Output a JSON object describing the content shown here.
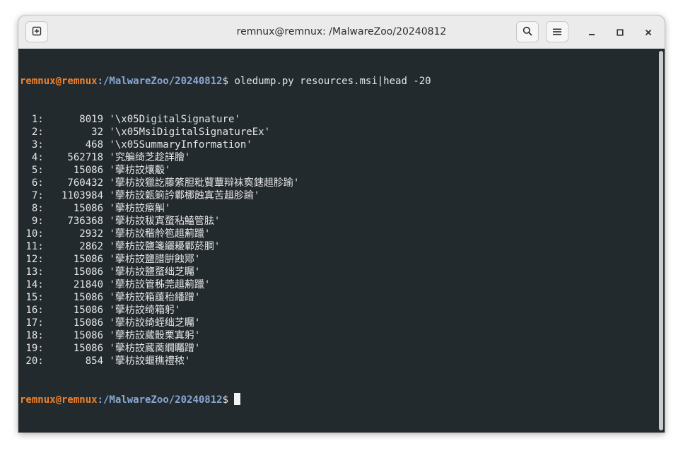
{
  "window": {
    "title": "remnux@remnux: /MalwareZoo/20240812",
    "new_tab_icon": "new-tab-icon",
    "search_icon": "search-icon",
    "menu_icon": "hamburger-menu-icon",
    "minimize_icon": "minimize-icon",
    "maximize_icon": "maximize-icon",
    "close_icon": "close-icon"
  },
  "colors": {
    "prompt_user": "#f0812a",
    "prompt_path": "#88a8d4",
    "terminal_bg": "#232a2e",
    "terminal_fg": "#e6e6e6"
  },
  "terminal": {
    "prompt_user": "remnux@remnux",
    "prompt_path": ":/MalwareZoo/20240812",
    "prompt_symbol": "$ ",
    "command": "oledump.py resources.msi|head -20",
    "output": [
      "  1:      8019 '\\x05DigitalSignature'",
      "  2:        32 '\\x05MsiDigitalSignatureEx'",
      "  3:       468 '\\x05SummaryInformation'",
      "  4:    562718 '究艑绮芝趁詳膾'",
      "  5:     15086 '䖂枋詨爙觳'",
      "  6:    760432 '䖂枋詨獵訖藤綮胆粃藖蕈辩袜寏鎋趄胗踰'",
      "  7:   1103984 '䖂枋詨甈箣訡鄿梛蝕寘苦趄胗踰'",
      "  8:     15086 '䖂枋詨瘵觓'",
      "  9:    736368 '䖂枋詨秡寘蝥秥鰪管胠'",
      " 10:      2932 '䖂枋詨稭舲笣趄葪躐'",
      " 11:      2862 '䖂枋詨鹽箋纚耰鄿菸胴'",
      " 12:     15086 '䖂枋詨鹽腊腁蝕鄍'",
      " 13:     15086 '䖂枋詨鹽蝥绌芝矚'",
      " 14:     21840 '䖂枋詨管秭莞趄葪躐'",
      " 15:     15086 '䖂枋詨箱蘐秮繙蹭'",
      " 16:     15086 '䖂枋詨绮箱躬'",
      " 17:     15086 '䖂枋詨绮蛭绌芝矚'",
      " 18:     15086 '䖂枋詨蕆骰栗寘躬'",
      " 19:     15086 '䖂枋詨蕆蔐繝矚蹭'",
      " 20:       854 '䖂枋詨蝘穛禮秾'"
    ],
    "final_prompt_user": "remnux@remnux",
    "final_prompt_path": ":/MalwareZoo/20240812",
    "final_prompt_symbol": "$ "
  }
}
